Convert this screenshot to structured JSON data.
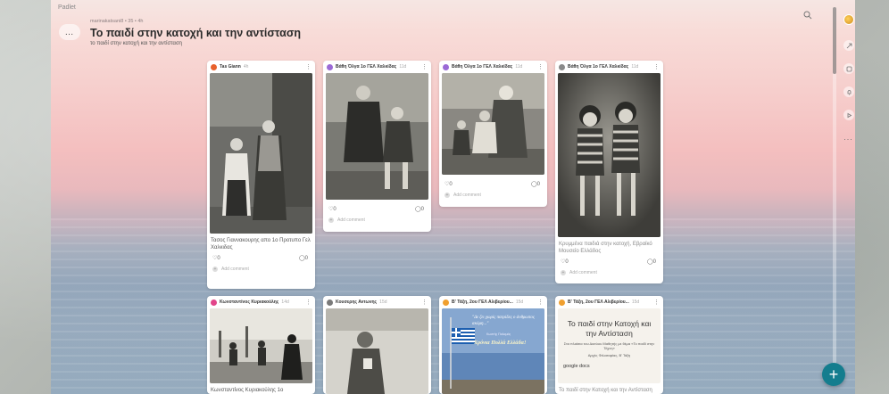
{
  "app": {
    "logo": "Padlet"
  },
  "header": {
    "meta": "marinakatsani8 • 35 • 4h",
    "title": "Το παιδί στην κατοχή και την αντίσταση",
    "subtitle": "το παιδί στην κατοχή και την αντίσταση",
    "more_icon": "…"
  },
  "fab": {
    "label": "+"
  },
  "colors": {
    "fab": "#147d8e"
  },
  "cards": [
    {
      "author": "Tas Giann",
      "time": "4h",
      "avatar_color": "#e8612c",
      "caption": "Τασος Γιαννακουρης απο 1ο Προτυπο Γελ Χαλκιδας",
      "likes": "0",
      "comments": "0",
      "add_comment": "Add comment"
    },
    {
      "author": "Βάθη Όλγα 1ο ΓΕΛ Χαλκίδας",
      "time": "11d",
      "avatar_color": "#9b6ad6",
      "likes": "0",
      "comments": "0",
      "add_comment": "Add comment"
    },
    {
      "author": "Βάθη Όλγα 1ο ΓΕΛ Χαλκίδας",
      "time": "11d",
      "avatar_color": "#9b6ad6",
      "likes": "0",
      "comments": "0",
      "add_comment": "Add comment"
    },
    {
      "author": "Βάθη Όλγα 1ο ΓΕΛ Χαλκίδας",
      "time": "11d",
      "avatar_color": "#8a8a8a",
      "caption": "Κρυμμένα παιδιά στην κατοχή, Εβραϊκό Μουσείο Ελλάδος",
      "likes": "0",
      "comments": "0",
      "add_comment": "Add comment"
    },
    {
      "author": "Κωνσταντίνος Κυριακούλης",
      "time": "14d",
      "avatar_color": "#e2458a",
      "caption": "Κωνσταντίνος Κυριακούλης 1ο"
    },
    {
      "author": "Κουσερης Αντωνης",
      "time": "15d",
      "avatar_color": "#7a7a7a"
    },
    {
      "author": "Β' Τάξη, 2ου ΓΕΛ Αλιβερίου...",
      "time": "15d",
      "avatar_color": "#f0a030",
      "banner_quote": "\"Δε ζει χωρίς πατρίδες ο άνθρωπος ακόμη...\"",
      "banner_author": "Κωστής Παλαμάς",
      "banner_slogan": "Χρόνια Πολλά Ελλάδα!"
    },
    {
      "author": "Β' Τάξη, 2ου ΓΕΛ Αλιβερίου...",
      "time": "15d",
      "avatar_color": "#f0a030",
      "doc_title": "Το παιδί στην Κατοχή και την Αντίσταση",
      "doc_line": "Στα πλαίσια του Δικτύου Μαθητής με θέμα «Το παιδί στην Τέχνη»",
      "doc_line2": "Αρχές Φιλοσοφίας, Β' Τάξη",
      "doc_source": "google docs",
      "caption": "Το παιδί στην Κατοχή και την Αντίσταση"
    }
  ]
}
